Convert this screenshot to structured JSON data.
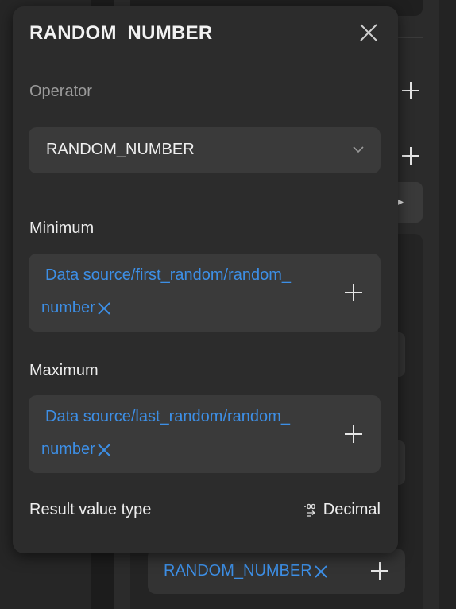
{
  "popover": {
    "title": "RANDOM_NUMBER",
    "operator": {
      "label": "Operator",
      "selected": "RANDOM_NUMBER"
    },
    "minimum": {
      "label": "Minimum",
      "line1": "Data source/first_random/random_",
      "line2": "number"
    },
    "maximum": {
      "label": "Maximum",
      "line1": "Data source/last_random/random_",
      "line2": "number"
    },
    "result": {
      "label": "Result value type",
      "value": "Decimal"
    }
  },
  "background": {
    "chip_text": "RANDOM_NUMBER"
  },
  "colors": {
    "accent": "#3d8fe6",
    "panel": "#2c2c2c",
    "field": "#3a3a3a"
  },
  "icons": [
    "close-icon",
    "chevron-down-icon",
    "plus-icon",
    "remove-x-icon",
    "decimal-type-icon",
    "arrow-right-icon"
  ]
}
